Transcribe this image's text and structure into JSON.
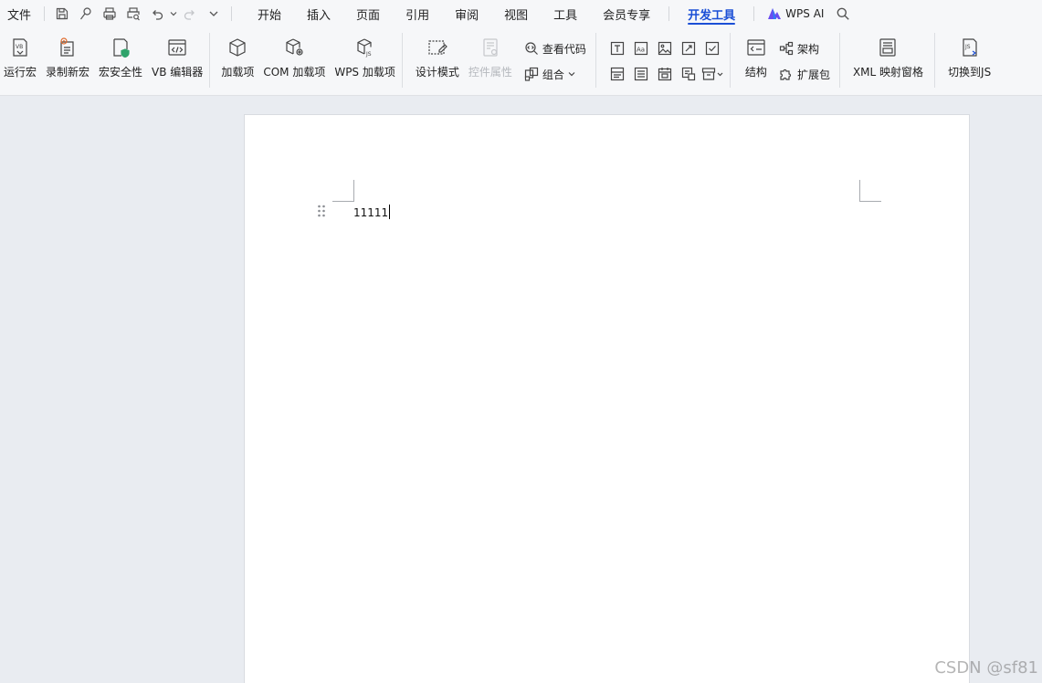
{
  "menubar": {
    "file": "文件",
    "tabs": [
      {
        "label": "开始"
      },
      {
        "label": "插入"
      },
      {
        "label": "页面"
      },
      {
        "label": "引用"
      },
      {
        "label": "审阅"
      },
      {
        "label": "视图"
      },
      {
        "label": "工具"
      },
      {
        "label": "会员专享"
      },
      {
        "label": "开发工具",
        "active": true
      }
    ],
    "wps_ai": "WPS AI"
  },
  "ribbon": {
    "run_macro": "运行宏",
    "record_macro": "录制新宏",
    "macro_security": "宏安全性",
    "vb_editor": "VB 编辑器",
    "addins": "加载项",
    "com_addins": "COM 加载项",
    "wps_addins": "WPS 加载项",
    "design_mode": "设计模式",
    "control_props": "控件属性",
    "view_code": "查看代码",
    "group": "组合",
    "structure": "结构",
    "schema": "架构",
    "expansion_pack": "扩展包",
    "xml_mapping": "XML 映射窗格",
    "switch_js": "切换到JS"
  },
  "document": {
    "text": "11111"
  },
  "watermark": "CSDN @sf81",
  "colors": {
    "accent": "#1b4fd6",
    "ribbon_bg": "#f6f7f9",
    "canvas_bg": "#e9ecf1"
  }
}
